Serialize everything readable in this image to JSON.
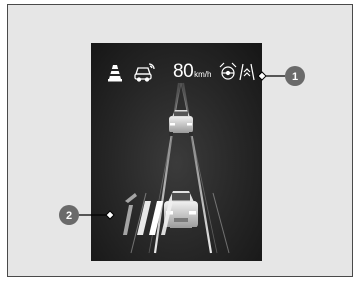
{
  "display": {
    "speed_value": "80",
    "speed_unit": "km/h"
  },
  "icons": [
    "traffic-cone-icon",
    "autonomous-car-icon",
    "steering-assist-icon",
    "lane-keeping-icon",
    "road-departure-icon"
  ],
  "callouts": [
    {
      "label": "1"
    },
    {
      "label": "2"
    }
  ],
  "colors": {
    "display_background": "#262626",
    "icon_color": "#ffffff",
    "callout_fill": "#6a6a6a"
  }
}
